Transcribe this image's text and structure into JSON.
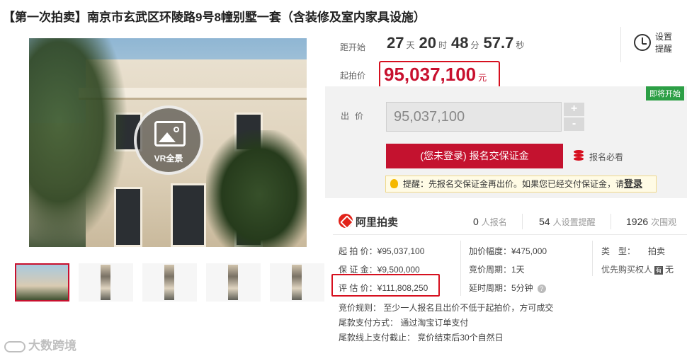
{
  "title": "【第一次拍卖】南京市玄武区环陵路9号8幢别墅一套（含装修及室内家具设施）",
  "gallery": {
    "vr_label": "VR全景",
    "thumbnail_count": 5,
    "active_thumbnail": 1
  },
  "countdown": {
    "label": "距开始",
    "days": "27",
    "days_unit": "天",
    "hours": "20",
    "hours_unit": "时",
    "minutes": "48",
    "minutes_unit": "分",
    "seconds": "57.7",
    "seconds_unit": "秒"
  },
  "remind": {
    "label": "设置提醒",
    "icon": "alarm-clock-icon"
  },
  "start_price": {
    "label": "起拍价",
    "value": "95,037,100",
    "unit": "元"
  },
  "status_tag": "即将开始",
  "bid": {
    "label": "出价",
    "value": "95,037,100",
    "plus": "+",
    "minus": "-",
    "apply_button": "(您未登录) 报名交保证金",
    "must_read": "报名必看",
    "tip_text": "提醒：先报名交保证金再出价。如果您已经交付保证金，请",
    "tip_login": "登录"
  },
  "platform": {
    "name": "阿里拍卖"
  },
  "stats": [
    {
      "value": "0",
      "label": "人报名"
    },
    {
      "value": "54",
      "label": "人设置提醒"
    },
    {
      "value": "1926",
      "label": "次围观"
    }
  ],
  "details": {
    "start_price": "起 拍 价：¥95,037,100",
    "deposit": "保 证 金：¥9,500,000",
    "estimate": "评 估 价：¥111,808,250",
    "increment": "加价幅度：¥475,000",
    "period": "竞价周期：1天",
    "extension": "延时周期：5分钟",
    "type_key": "类　型：",
    "type_value": "拍卖",
    "priority_key": "优先购买权人",
    "priority_badge": "有",
    "priority_value": "无",
    "rule": "竞价规则：  至少一人报名且出价不低于起拍价，方可成交",
    "payment": "尾款支付方式：  通过淘宝订单支付",
    "deadline": "尾款线上支付截止：  竞价结束后30个自然日"
  },
  "watermark": "大数跨境",
  "colors": {
    "accent_red": "#c8102e",
    "soon_green": "#2c9f45",
    "panel_gray": "#f2f2f2"
  }
}
